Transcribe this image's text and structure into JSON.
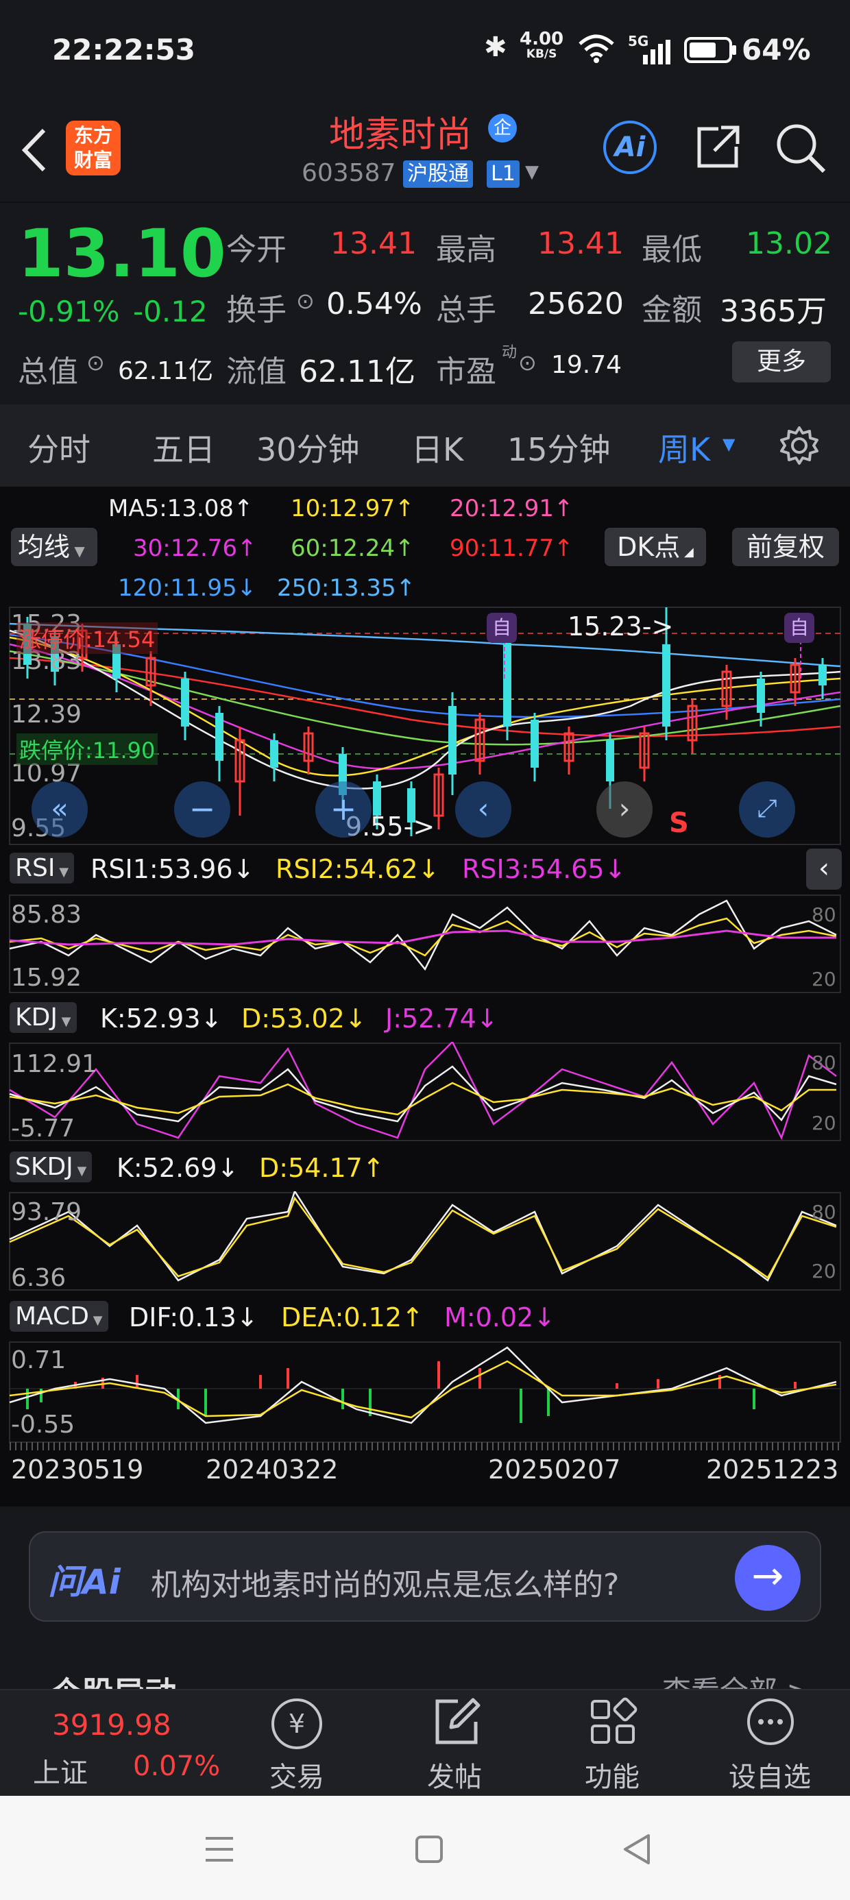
{
  "status_bar": {
    "time": "22:22:53",
    "net_speed": "4.00",
    "net_unit": "KB/S",
    "signal": "5G",
    "battery": "64%"
  },
  "header": {
    "logo_line1": "东方",
    "logo_line2": "财富",
    "title": "地素时尚",
    "badge": "企",
    "code": "603587",
    "tag1": "沪股通",
    "tag2": "L1",
    "ai_label": "Ai"
  },
  "quote": {
    "price": "13.10",
    "change_pct": "-0.91%",
    "change": "-0.12",
    "open_label": "今开",
    "open": "13.41",
    "high_label": "最高",
    "high": "13.41",
    "low_label": "最低",
    "low": "13.02",
    "turnover_label": "换手",
    "turnover": "0.54%",
    "volume_label": "总手",
    "volume": "25620",
    "amount_label": "金额",
    "amount": "3365万",
    "mcap_label": "总值",
    "mcap": "62.11亿",
    "float_label": "流值",
    "float_mcap": "62.11亿",
    "pe_label": "市盈",
    "pe_sup": "动",
    "pe": "19.74",
    "more_label": "更多"
  },
  "tabs": [
    "分时",
    "五日",
    "30分钟",
    "日K",
    "15分钟",
    "周K"
  ],
  "active_tab": "周K",
  "chart_controls": {
    "ma_label": "均线",
    "dk_label": "DK点",
    "fq_label": "前复权"
  },
  "ma_legend": {
    "ma5": "MA5:13.08↑",
    "ma10": "10:12.97↑",
    "ma20": "20:12.91↑",
    "ma30": "30:12.76↑",
    "ma60": "60:12.24↑",
    "ma90": "90:11.77↑",
    "ma120": "120:11.95↓",
    "ma250": "250:13.35↑"
  },
  "main_chart": {
    "y_top": "15.23",
    "y_2": "13.83",
    "y_3": "12.39",
    "y_4": "10.97",
    "y_bottom": "9.55",
    "limit_up": "涨停价:14.54",
    "limit_down": "跌停价:11.90",
    "max_annot": "15.23->",
    "min_annot": "9.55->",
    "marker_zi": "自",
    "marker_s": "S"
  },
  "rsi": {
    "name": "RSI",
    "v1": "RSI1:53.96↓",
    "v2": "RSI2:54.62↓",
    "v3": "RSI3:54.65↓",
    "y_top": "85.83",
    "y_bottom": "15.92",
    "r80": "80",
    "r20": "20"
  },
  "kdj": {
    "name": "KDJ",
    "k": "K:52.93↓",
    "d": "D:53.02↓",
    "j": "J:52.74↓",
    "y_top": "112.91",
    "y_bottom": "-5.77",
    "r80": "80",
    "r20": "20"
  },
  "skdj": {
    "name": "SKDJ",
    "k": "K:52.69↓",
    "d": "D:54.17↑",
    "y_top": "93.79",
    "y_bottom": "6.36",
    "r80": "80",
    "r20": "20"
  },
  "macd": {
    "name": "MACD",
    "dif": "DIF:0.13↓",
    "dea": "DEA:0.12↑",
    "m": "M:0.02↓",
    "y_top": "0.71",
    "y_bottom": "-0.55"
  },
  "x_dates": [
    "20230519",
    "20240322",
    "20250207",
    "20251223"
  ],
  "ask_ai": {
    "label": "问Ai",
    "placeholder": "机构对地素时尚的观点是怎么样的?"
  },
  "partial_section": {
    "left": "个股异动",
    "right": "查看全部 >"
  },
  "bottom_nav": {
    "index_value": "3919.98",
    "index_name": "上证",
    "index_change": "0.07%",
    "trade": "交易",
    "post": "发帖",
    "func": "功能",
    "watch": "设自选"
  }
}
